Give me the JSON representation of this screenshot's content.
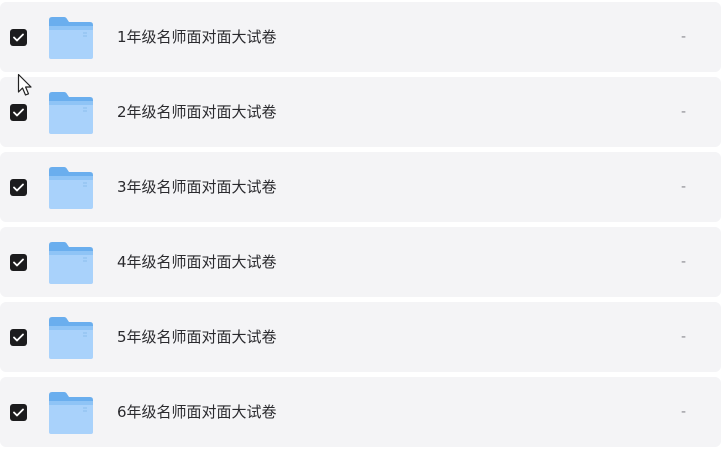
{
  "files": [
    {
      "name": "1年级名师面对面大试卷",
      "meta": "-",
      "checked": true,
      "icon": "folder-icon"
    },
    {
      "name": "2年级名师面对面大试卷",
      "meta": "-",
      "checked": true,
      "icon": "folder-icon"
    },
    {
      "name": "3年级名师面对面大试卷",
      "meta": "-",
      "checked": true,
      "icon": "folder-icon"
    },
    {
      "name": "4年级名师面对面大试卷",
      "meta": "-",
      "checked": true,
      "icon": "folder-icon"
    },
    {
      "name": "5年级名师面对面大试卷",
      "meta": "-",
      "checked": true,
      "icon": "folder-icon"
    },
    {
      "name": "6年级名师面对面大试卷",
      "meta": "-",
      "checked": true,
      "icon": "folder-icon"
    }
  ],
  "colors": {
    "row_bg": "#f4f4f6",
    "checkbox": "#1c1c1e",
    "folder_light": "#a9d2fb",
    "folder_dark": "#6aaeee"
  }
}
